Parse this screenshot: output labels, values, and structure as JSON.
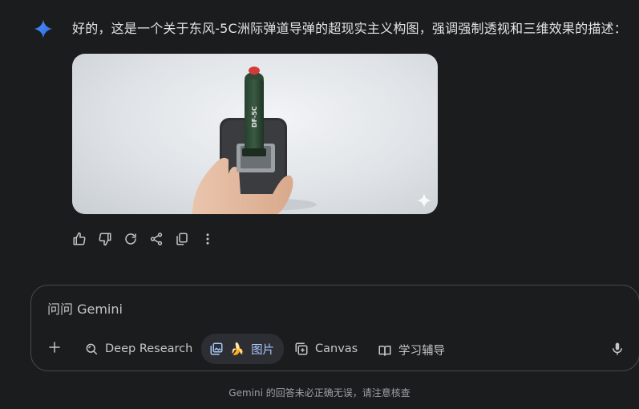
{
  "response": {
    "text": "好的，这是一个关于东风-5C洲际弹道导弹的超现实主义构图，强调强制透视和三维效果的描述：",
    "image": {
      "missile_label": "DF-5C",
      "badge_icon": "sparkle-icon"
    }
  },
  "actions": [
    {
      "name": "thumbs-up-icon"
    },
    {
      "name": "thumbs-down-icon"
    },
    {
      "name": "regenerate-icon"
    },
    {
      "name": "share-icon"
    },
    {
      "name": "copy-icon"
    },
    {
      "name": "more-vert-icon"
    }
  ],
  "composer": {
    "placeholder": "问问 Gemini",
    "add_icon": "plus-icon",
    "tools": {
      "deep_research": "Deep Research",
      "image_emoji": "🍌",
      "image": "图片",
      "canvas": "Canvas",
      "learning": "学习辅导"
    },
    "mic_icon": "microphone-icon"
  },
  "footer": {
    "disclaimer": "Gemini 的回答未必正确无误，请注意核查"
  },
  "colors": {
    "background": "#1b1c1d",
    "text": "#e3e3e3",
    "accent": "#a8c7fa",
    "border": "#4a4b4d"
  }
}
